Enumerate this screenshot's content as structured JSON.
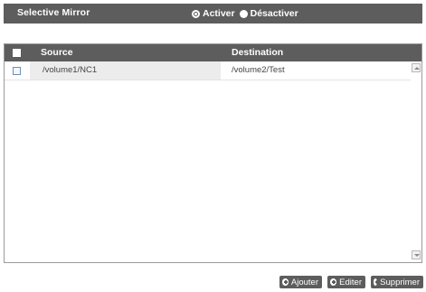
{
  "header": {
    "title": "Selective Mirror",
    "options": [
      {
        "label": "Activer",
        "selected": true
      },
      {
        "label": "Désactiver",
        "selected": false
      }
    ]
  },
  "table": {
    "columns": {
      "source": "Source",
      "destination": "Destination"
    },
    "rows": [
      {
        "source": "/volume1/NC1",
        "destination": "/volume2/Test"
      }
    ]
  },
  "buttons": {
    "add": "Ajouter",
    "edit": "Editer",
    "delete": "Supprimer"
  }
}
